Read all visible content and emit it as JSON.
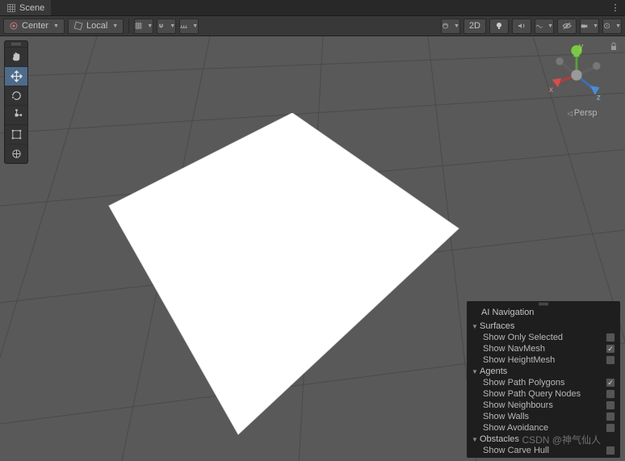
{
  "tab": {
    "title": "Scene"
  },
  "toolbar": {
    "pivot": "Center",
    "handle": "Local",
    "mode2d": "2D"
  },
  "gizmo": {
    "axis_x": "x",
    "axis_y": "y",
    "axis_z": "z",
    "projection": "Persp"
  },
  "nav": {
    "title": "AI Navigation",
    "sections": [
      {
        "label": "Surfaces",
        "items": [
          {
            "label": "Show Only Selected",
            "checked": false
          },
          {
            "label": "Show NavMesh",
            "checked": true
          },
          {
            "label": "Show HeightMesh",
            "checked": false
          }
        ]
      },
      {
        "label": "Agents",
        "items": [
          {
            "label": "Show Path Polygons",
            "checked": true
          },
          {
            "label": "Show Path Query Nodes",
            "checked": false
          },
          {
            "label": "Show Neighbours",
            "checked": false
          },
          {
            "label": "Show Walls",
            "checked": false
          },
          {
            "label": "Show Avoidance",
            "checked": false
          }
        ]
      },
      {
        "label": "Obstacles",
        "items": [
          {
            "label": "Show Carve Hull",
            "checked": false
          }
        ]
      }
    ]
  },
  "watermark": "CSDN @神气仙人"
}
